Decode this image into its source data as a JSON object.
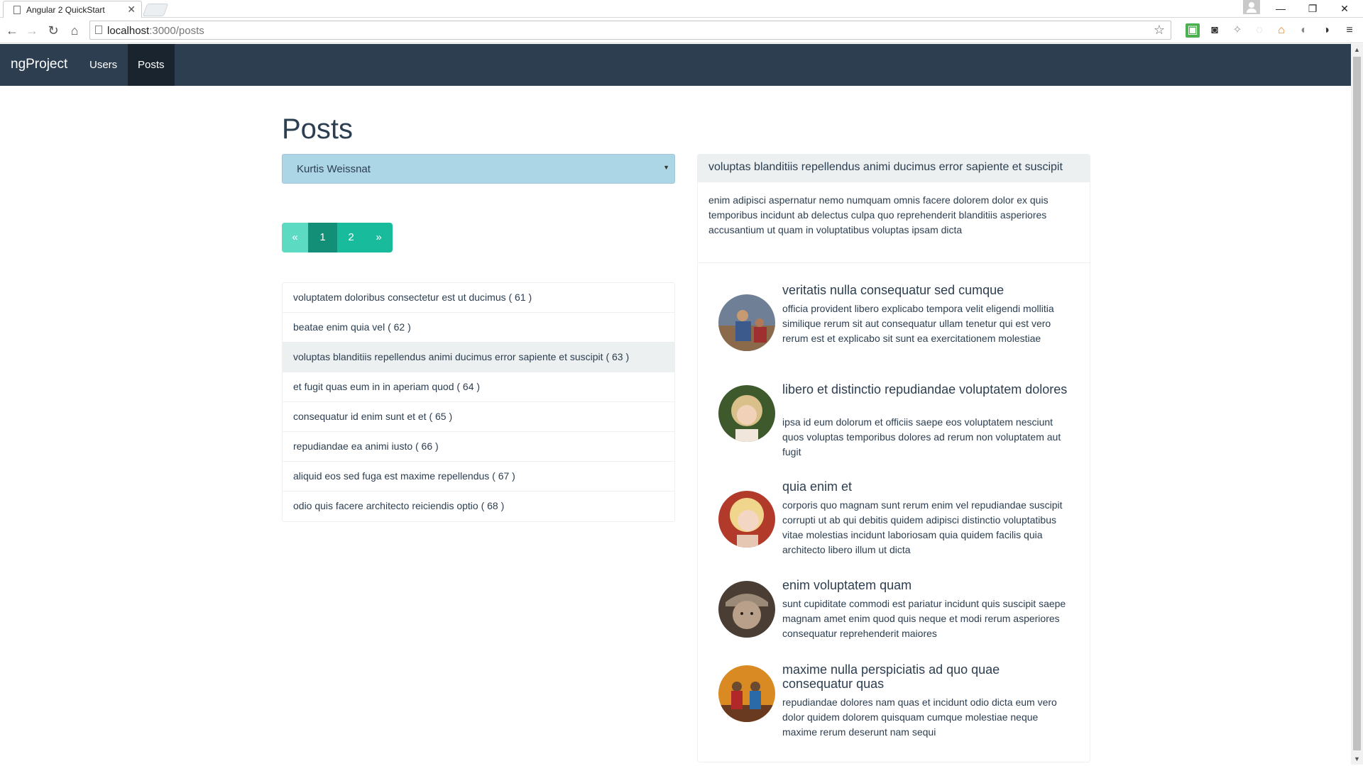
{
  "browser": {
    "tab_title": "Angular 2 QuickStart",
    "url_host": "localhost",
    "url_path": ":3000/posts"
  },
  "navbar": {
    "brand": "ngProject",
    "links": [
      "Users",
      "Posts"
    ],
    "active": "Posts"
  },
  "main": {
    "title": "Posts",
    "selected_user": "Kurtis Weissnat",
    "pagination": {
      "prev": "«",
      "pages": [
        "1",
        "2"
      ],
      "next": "»",
      "current": "1"
    },
    "posts": [
      "voluptatem doloribus consectetur est ut ducimus ( 61 )",
      "beatae enim quia vel ( 62 )",
      "voluptas blanditiis repellendus animi ducimus error sapiente et suscipit ( 63 )",
      "et fugit quas eum in in aperiam quod ( 64 )",
      "consequatur id enim sunt et et ( 65 )",
      "repudiandae ea animi iusto ( 66 )",
      "aliquid eos sed fuga est maxime repellendus ( 67 )",
      "odio quis facere architecto reiciendis optio ( 68 )"
    ],
    "selected_post_index": 2
  },
  "detail": {
    "title": "voluptas blanditiis repellendus animi ducimus error sapiente et suscipit",
    "body": "enim adipisci aspernatur nemo numquam omnis facere dolorem dolor ex quis temporibus incidunt ab delectus culpa quo reprehenderit blanditiis asperiores accusantium ut quam in voluptatibus voluptas ipsam dicta",
    "comments": [
      {
        "title": "veritatis nulla consequatur sed cumque",
        "body": "officia provident libero explicabo tempora velit eligendi mollitia similique rerum sit aut consequatur ullam tenetur qui est vero rerum est et explicabo sit sunt ea exercitationem molestiae"
      },
      {
        "title": "libero et distinctio repudiandae voluptatem dolores",
        "body": "ipsa id eum dolorum et officiis saepe eos voluptatem nesciunt quos voluptas temporibus dolores ad rerum non voluptatem aut fugit"
      },
      {
        "title": "quia enim et",
        "body": "corporis quo magnam sunt rerum enim vel repudiandae suscipit corrupti ut ab qui debitis quidem adipisci distinctio voluptatibus vitae molestias incidunt laboriosam quia quidem facilis quia architecto libero illum ut dicta"
      },
      {
        "title": "enim voluptatem quam",
        "body": "sunt cupiditate commodi est pariatur incidunt quis suscipit saepe magnam amet enim quod quis neque et modi rerum asperiores consequatur reprehenderit maiores"
      },
      {
        "title": "maxime nulla perspiciatis ad quo quae consequatur quas",
        "body": "repudiandae dolores nam quas et incidunt odio dicta eum vero dolor quidem dolorem quisquam cumque molestiae neque maxime rerum deserunt nam sequi"
      }
    ]
  },
  "colors": {
    "navbar": "#2c3e50",
    "navbar_active": "#1a242f",
    "accent": "#18bc9c",
    "accent_active": "#128f76",
    "select_bg": "#acd6e6",
    "list_selected": "#ecf0f1"
  }
}
